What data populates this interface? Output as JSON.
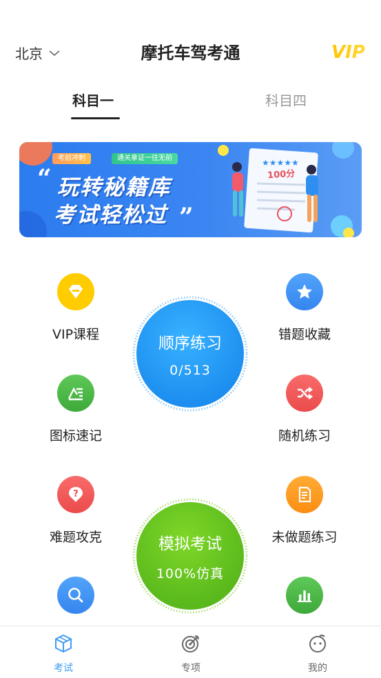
{
  "header": {
    "city": "北京",
    "title": "摩托车驾考通",
    "vip_logo_text": "VIP"
  },
  "tabs": [
    {
      "label": "科目一",
      "active": true
    },
    {
      "label": "科目四",
      "active": false
    }
  ],
  "banner": {
    "tag_left": "考前冲刺",
    "tag_right": "通关拿证一往无前",
    "line1": "玩转秘籍库",
    "line2": "考试轻松过",
    "score": "100分"
  },
  "features": {
    "vip_course": {
      "label": "VIP课程",
      "icon": "vip-diamond-icon",
      "color": "#ffcc00"
    },
    "wrong_collect": {
      "label": "错题收藏",
      "icon": "star-icon",
      "color": "#3f90f5"
    },
    "sign_memory": {
      "label": "图标速记",
      "icon": "sign-icon",
      "color": "#4cb84a"
    },
    "random_practice": {
      "label": "随机练习",
      "icon": "shuffle-icon",
      "color": "#f25a5a"
    },
    "hard_questions": {
      "label": "难题攻克",
      "icon": "question-icon",
      "color": "#f25a5a"
    },
    "undone_practice": {
      "label": "未做题练习",
      "icon": "document-icon",
      "color": "#ff9a1f"
    },
    "search": {
      "label": "",
      "icon": "search-icon",
      "color": "#3f90f5"
    },
    "stats": {
      "label": "",
      "icon": "bar-chart-icon",
      "color": "#4cb84a"
    }
  },
  "sequential": {
    "title": "顺序练习",
    "progress": "0/513",
    "color": "#1d8ff0"
  },
  "mock_exam": {
    "title": "模拟考试",
    "subtitle": "100%仿真",
    "color": "#5ab91c"
  },
  "nav": [
    {
      "label": "考试",
      "icon": "cube-icon",
      "active": true,
      "color": "#3f9bf5"
    },
    {
      "label": "专项",
      "icon": "target-icon",
      "active": false,
      "color": "#666666"
    },
    {
      "label": "我的",
      "icon": "face-icon",
      "active": false,
      "color": "#666666"
    }
  ]
}
